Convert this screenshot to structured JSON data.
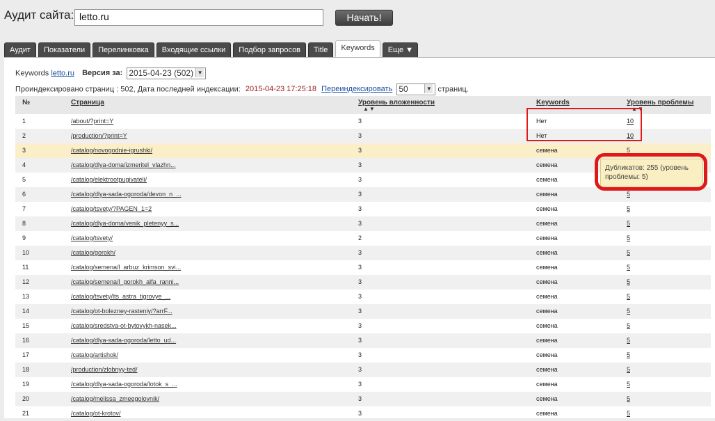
{
  "header": {
    "audit_label": "Аудит сайта:",
    "url_value": "letto.ru",
    "start_button": "Начать!"
  },
  "tabs": [
    {
      "label": "Аудит"
    },
    {
      "label": "Показатели"
    },
    {
      "label": "Перелинковка"
    },
    {
      "label": "Входящие ссылки"
    },
    {
      "label": "Подбор запросов"
    },
    {
      "label": "Title"
    },
    {
      "label": "Keywords"
    },
    {
      "label": "Еще ▼"
    }
  ],
  "keywords_line": {
    "prefix": "Keywords",
    "site": "letto.ru",
    "version_label": "Версия за:",
    "version_value": "2015-04-23 (502)"
  },
  "index_line": {
    "text": "Проиндексировано страниц : 502, Дата последней индексации:",
    "date": "2015-04-23 17:25:18",
    "reindex": "Переиндексировать",
    "per_page": "50",
    "pages_suffix": "страниц."
  },
  "table": {
    "headers": {
      "num": "№",
      "page": "Страница",
      "depth": "Уровень вложенности",
      "keywords": "Keywords",
      "level": "Уровень проблемы"
    },
    "rows": [
      {
        "n": "1",
        "page": "/about/?print=Y",
        "depth": "3",
        "kw": "Нет",
        "level": "10"
      },
      {
        "n": "2",
        "page": "/production/?print=Y",
        "depth": "3",
        "kw": "Нет",
        "level": "10"
      },
      {
        "n": "3",
        "page": "/catalog/novogodnie-igrushki/",
        "depth": "3",
        "kw": "семена",
        "level": "5"
      },
      {
        "n": "4",
        "page": "/catalog/dlya-doma/izmeritel_vlazhn...",
        "depth": "3",
        "kw": "семена",
        "level": "5"
      },
      {
        "n": "5",
        "page": "/catalog/elektrootpugivateli/",
        "depth": "3",
        "kw": "семена",
        "level": "5"
      },
      {
        "n": "6",
        "page": "/catalog/dlya-sada-ogoroda/devon_n_...",
        "depth": "3",
        "kw": "семена",
        "level": "5"
      },
      {
        "n": "7",
        "page": "/catalog/tsvety/?PAGEN_1=2",
        "depth": "3",
        "kw": "семена",
        "level": "5"
      },
      {
        "n": "8",
        "page": "/catalog/dlya-doma/venik_pletenyy_s...",
        "depth": "3",
        "kw": "семена",
        "level": "5"
      },
      {
        "n": "9",
        "page": "/catalog/tsvety/",
        "depth": "2",
        "kw": "семена",
        "level": "5"
      },
      {
        "n": "10",
        "page": "/catalog/gorokh/",
        "depth": "3",
        "kw": "семена",
        "level": "5"
      },
      {
        "n": "11",
        "page": "/catalog/semena/l_arbuz_krimson_svi...",
        "depth": "3",
        "kw": "семена",
        "level": "5"
      },
      {
        "n": "12",
        "page": "/catalog/semena/l_gorokh_alfa_ranni...",
        "depth": "3",
        "kw": "семена",
        "level": "5"
      },
      {
        "n": "13",
        "page": "/catalog/tsvety/lts_astra_tigrovye_...",
        "depth": "3",
        "kw": "семена",
        "level": "5"
      },
      {
        "n": "14",
        "page": "/catalog/ot-bolezney-rasteniy/?arrF...",
        "depth": "3",
        "kw": "семена",
        "level": "5"
      },
      {
        "n": "15",
        "page": "/catalog/sredstva-ot-bytovykh-nasek...",
        "depth": "3",
        "kw": "семена",
        "level": "5"
      },
      {
        "n": "16",
        "page": "/catalog/dlya-sada-ogoroda/letto_ud...",
        "depth": "3",
        "kw": "семена",
        "level": "5"
      },
      {
        "n": "17",
        "page": "/catalog/artishok/",
        "depth": "3",
        "kw": "семена",
        "level": "5"
      },
      {
        "n": "18",
        "page": "/production/zlobnyy-ted/",
        "depth": "3",
        "kw": "семена",
        "level": "5"
      },
      {
        "n": "19",
        "page": "/catalog/dlya-sada-ogoroda/lotok_s_...",
        "depth": "3",
        "kw": "семена",
        "level": "5"
      },
      {
        "n": "20",
        "page": "/catalog/melissa_zmeegolovnik/",
        "depth": "3",
        "kw": "семена",
        "level": "5"
      },
      {
        "n": "21",
        "page": "/catalog/ot-krotov/",
        "depth": "3",
        "kw": "семена",
        "level": "5"
      }
    ]
  },
  "tooltip": {
    "text": "Дубликатов: 255 (уровень проблемы: 5)"
  },
  "colors": {
    "highlight_row": "#fbefc9",
    "annotation_red": "#e01818",
    "tab_dark": "#4a4a4a"
  }
}
